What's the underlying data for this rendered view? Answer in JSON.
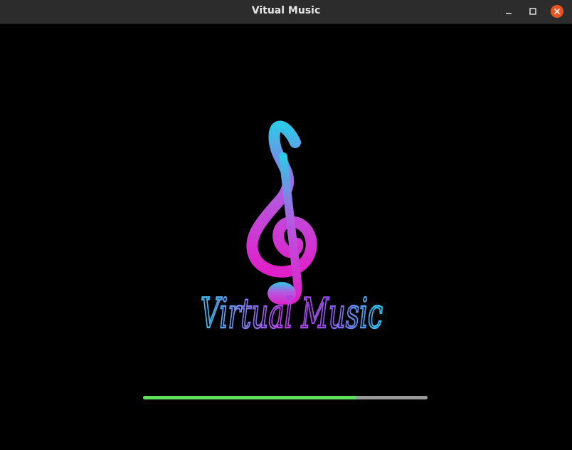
{
  "window": {
    "title": "Vitual Music"
  },
  "controls": {
    "minimize_icon": "minimize-icon",
    "maximize_icon": "maximize-icon",
    "close_icon": "close-icon",
    "close_color": "#e95420"
  },
  "splash": {
    "logo_icon": "treble-clef-icon",
    "logo_text": "Virtual Music",
    "progress": 0.75,
    "progress_color": "#5ee05a",
    "track_color": "#9a9a9a"
  }
}
